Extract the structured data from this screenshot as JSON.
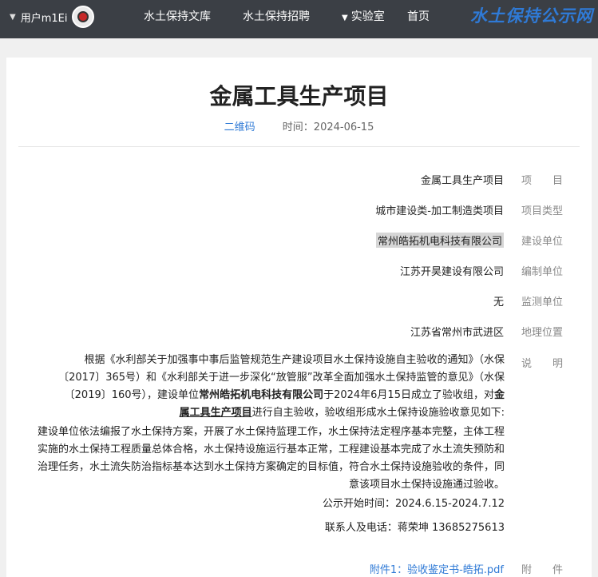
{
  "header": {
    "user_label": "用户m1Ei",
    "nav": [
      "水土保持文库",
      "水土保持招聘",
      "实验室",
      "首页"
    ],
    "logo": "水土保持公示网"
  },
  "page": {
    "title": "金属工具生产项目",
    "time_label": "时间：2024-06-15",
    "qr_label": "二维码"
  },
  "fields": [
    {
      "label": "项　　目",
      "value": "金属工具生产项目"
    },
    {
      "label": "项目类型",
      "value": "城市建设类-加工制造类项目"
    },
    {
      "label": "建设单位",
      "value": "常州皓拓机电科技有限公司"
    },
    {
      "label": "编制单位",
      "value": "江苏开昊建设有限公司"
    },
    {
      "label": "监测单位",
      "value": "无"
    },
    {
      "label": "地理位置",
      "value": "江苏省常州市武进区"
    },
    {
      "label": "说　　明",
      "value": ""
    }
  ],
  "description": {
    "p1_line1": "根据《水利部关于加强事中事后监管规范生产建设项目水土保持设施自主验收的通知》（水保",
    "p1_line2": "〔2017〕365号）和《水利部关于进一步深化“放管服”改革全面加强水土保持监管的意见》（水保",
    "p1_line3a": "〔2019〕160号），建设单位",
    "p1_company": "常州皓拓机电科技有限公司",
    "p1_line3b": "于2024年6月15日成立了验收组，对",
    "p1_proj_a": "金",
    "p1_proj_b": "属工具生产项目",
    "p1_line4": "进行自主验收，验收组形成水土保持设施验收意见如下:",
    "p2": "建设单位依法编报了水土保持方案，开展了水土保持监理工作，水土保持法定程序基本完整，主体工程实施的水土保持工程质量总体合格，水土保持设施运行基本正常，工程建设基本完成了水土流失预防和治理任务，水土流失防治指标基本达到水土保持方案确定的目标值，符合水土保持设施验收的条件，同意该项目水土保持设施通过验收。",
    "p3": "公示开始时间：2024.6.15-2024.7.12",
    "p4": "联系人及电话：蒋荣坤  13685275613"
  },
  "attachment": {
    "label": "附　　件",
    "file": "附件1：验收鉴定书-皓拓.pdf"
  }
}
